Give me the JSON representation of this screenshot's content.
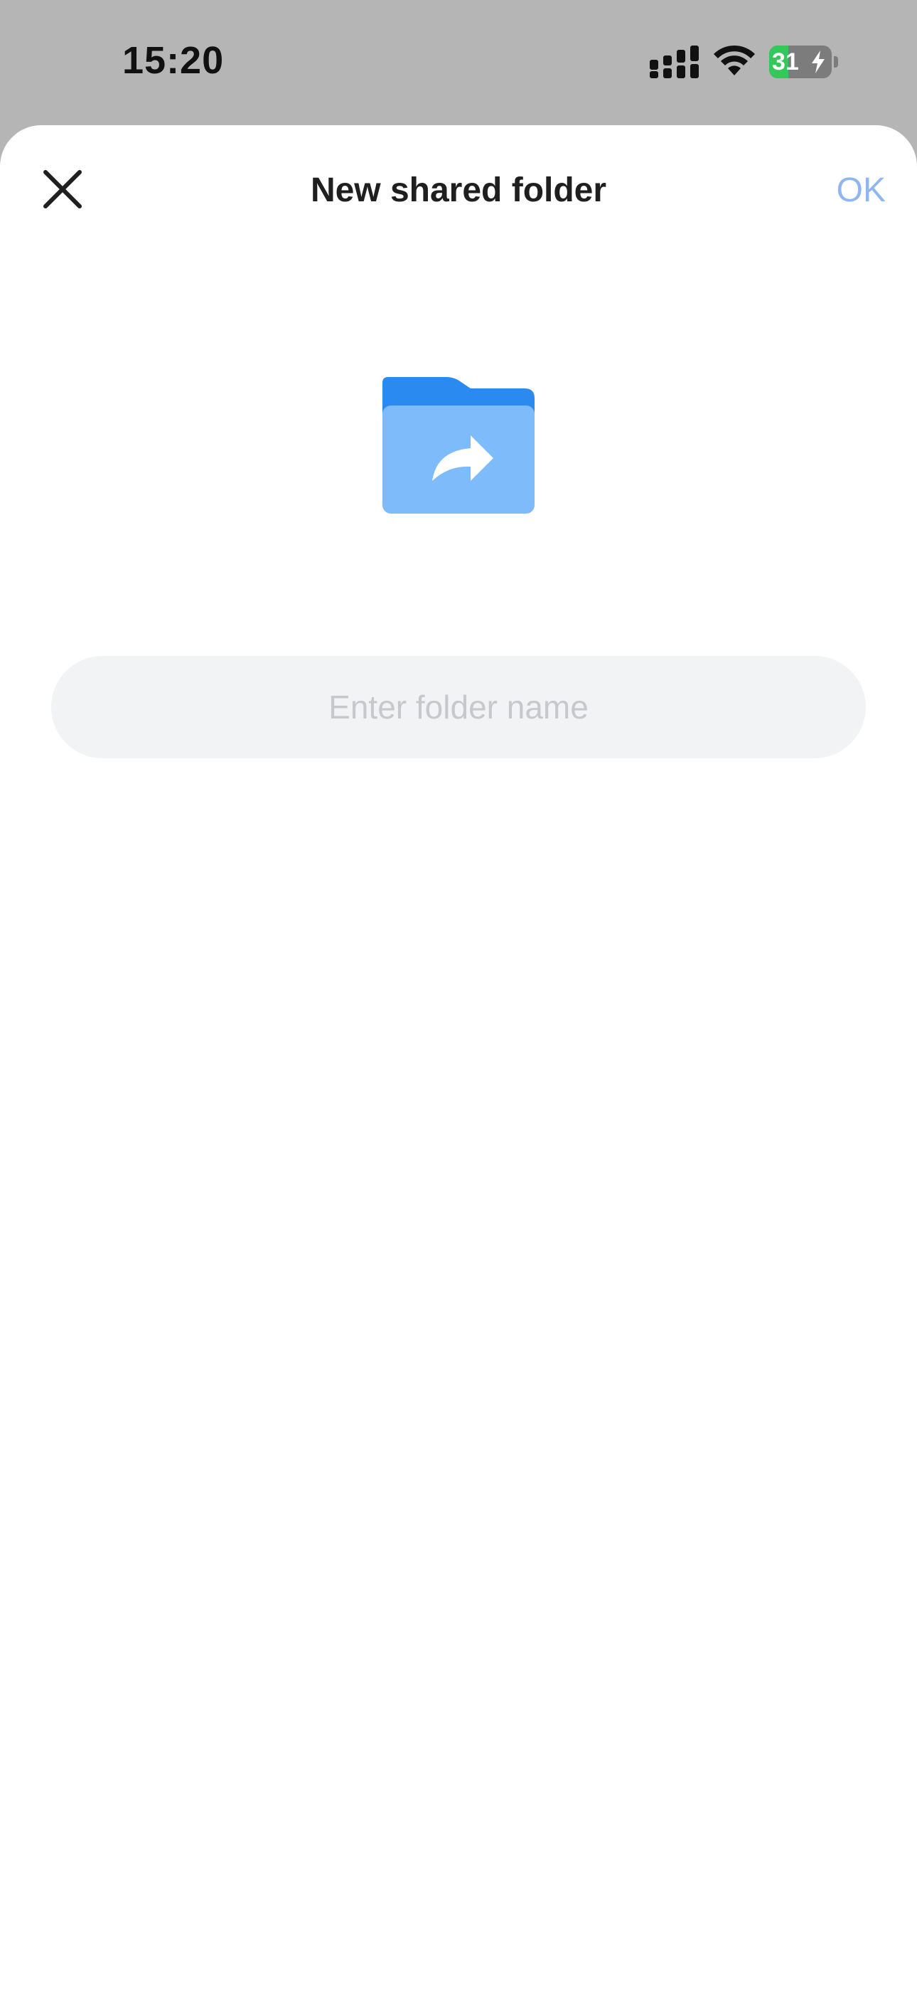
{
  "status_bar": {
    "time": "15:20",
    "battery_level": "31",
    "battery_fraction": 0.31,
    "battery_charging": true,
    "icons": [
      "signal-icon",
      "wifi-icon",
      "battery-icon",
      "charging-bolt-icon"
    ]
  },
  "sheet": {
    "title": "New shared folder",
    "close_icon": "close-icon",
    "ok_label": "OK",
    "folder_icon": "shared-folder-icon",
    "folder_name_input": {
      "value": "",
      "placeholder": "Enter folder name"
    }
  },
  "colors": {
    "status_bar_bg": "#b5b5b5",
    "sheet_bg": "#ffffff",
    "ok_disabled": "#8fb6f2",
    "folder_dark": "#2a8af0",
    "folder_light": "#7dbbfb",
    "input_bg": "#f2f3f4",
    "placeholder": "#c6c8cc",
    "battery_green": "#34c759"
  }
}
